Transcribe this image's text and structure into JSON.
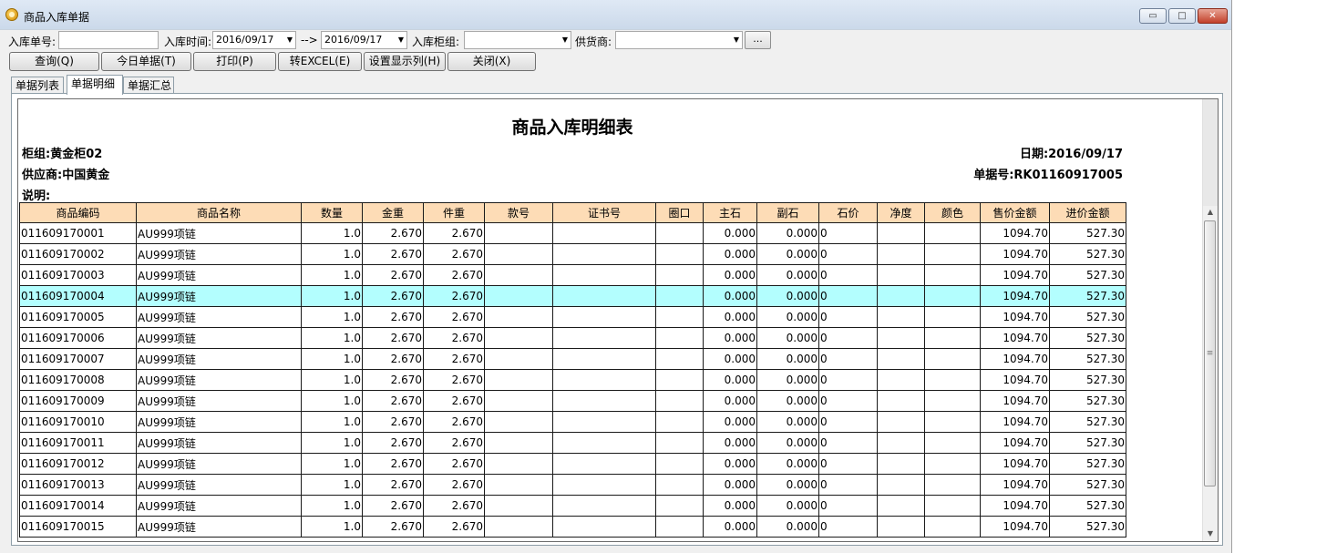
{
  "window": {
    "title": "商品入库单据",
    "min_label": "▭",
    "max_label": "□",
    "close_label": "✕"
  },
  "filters": {
    "order_no_label": "入库单号:",
    "order_no_value": "",
    "time_label": "入库时间:",
    "date_from": "2016/09/17",
    "arrow": "-->",
    "date_to": "2016/09/17",
    "counter_label": "入库柜组:",
    "counter_value": "",
    "supplier_label": "供货商:",
    "supplier_value": "",
    "more_label": "..."
  },
  "toolbar": {
    "query": "查询(Q)",
    "today": "今日单据(T)",
    "print": "打印(P)",
    "excel": "转EXCEL(E)",
    "columns": "设置显示列(H)",
    "close": "关闭(X)"
  },
  "tabs": [
    "单据列表",
    "单据明细",
    "单据汇总"
  ],
  "active_tab": "单据明细",
  "report": {
    "title": "商品入库明细表",
    "counter": "柜组:黄金柜02",
    "supplier": "供应商:中国黄金",
    "note": "说明:",
    "date": "日期:2016/09/17",
    "doc_no": "单据号:RK01160917005"
  },
  "table": {
    "headers": [
      "商品编码",
      "商品名称",
      "数量",
      "金重",
      "件重",
      "款号",
      "证书号",
      "圈口",
      "主石",
      "副石",
      "石价",
      "净度",
      "颜色",
      "售价金额",
      "进价金额"
    ],
    "rows": [
      [
        "011609170001",
        "AU999项链",
        "1.0",
        "2.670",
        "2.670",
        "",
        "",
        "",
        "0.000",
        "0.000",
        "0",
        "",
        "",
        "1094.70",
        "527.30"
      ],
      [
        "011609170002",
        "AU999项链",
        "1.0",
        "2.670",
        "2.670",
        "",
        "",
        "",
        "0.000",
        "0.000",
        "0",
        "",
        "",
        "1094.70",
        "527.30"
      ],
      [
        "011609170003",
        "AU999项链",
        "1.0",
        "2.670",
        "2.670",
        "",
        "",
        "",
        "0.000",
        "0.000",
        "0",
        "",
        "",
        "1094.70",
        "527.30"
      ],
      [
        "011609170004",
        "AU999项链",
        "1.0",
        "2.670",
        "2.670",
        "",
        "",
        "",
        "0.000",
        "0.000",
        "0",
        "",
        "",
        "1094.70",
        "527.30"
      ],
      [
        "011609170005",
        "AU999项链",
        "1.0",
        "2.670",
        "2.670",
        "",
        "",
        "",
        "0.000",
        "0.000",
        "0",
        "",
        "",
        "1094.70",
        "527.30"
      ],
      [
        "011609170006",
        "AU999项链",
        "1.0",
        "2.670",
        "2.670",
        "",
        "",
        "",
        "0.000",
        "0.000",
        "0",
        "",
        "",
        "1094.70",
        "527.30"
      ],
      [
        "011609170007",
        "AU999项链",
        "1.0",
        "2.670",
        "2.670",
        "",
        "",
        "",
        "0.000",
        "0.000",
        "0",
        "",
        "",
        "1094.70",
        "527.30"
      ],
      [
        "011609170008",
        "AU999项链",
        "1.0",
        "2.670",
        "2.670",
        "",
        "",
        "",
        "0.000",
        "0.000",
        "0",
        "",
        "",
        "1094.70",
        "527.30"
      ],
      [
        "011609170009",
        "AU999项链",
        "1.0",
        "2.670",
        "2.670",
        "",
        "",
        "",
        "0.000",
        "0.000",
        "0",
        "",
        "",
        "1094.70",
        "527.30"
      ],
      [
        "011609170010",
        "AU999项链",
        "1.0",
        "2.670",
        "2.670",
        "",
        "",
        "",
        "0.000",
        "0.000",
        "0",
        "",
        "",
        "1094.70",
        "527.30"
      ],
      [
        "011609170011",
        "AU999项链",
        "1.0",
        "2.670",
        "2.670",
        "",
        "",
        "",
        "0.000",
        "0.000",
        "0",
        "",
        "",
        "1094.70",
        "527.30"
      ],
      [
        "011609170012",
        "AU999项链",
        "1.0",
        "2.670",
        "2.670",
        "",
        "",
        "",
        "0.000",
        "0.000",
        "0",
        "",
        "",
        "1094.70",
        "527.30"
      ],
      [
        "011609170013",
        "AU999项链",
        "1.0",
        "2.670",
        "2.670",
        "",
        "",
        "",
        "0.000",
        "0.000",
        "0",
        "",
        "",
        "1094.70",
        "527.30"
      ],
      [
        "011609170014",
        "AU999项链",
        "1.0",
        "2.670",
        "2.670",
        "",
        "",
        "",
        "0.000",
        "0.000",
        "0",
        "",
        "",
        "1094.70",
        "527.30"
      ],
      [
        "011609170015",
        "AU999项链",
        "1.0",
        "2.670",
        "2.670",
        "",
        "",
        "",
        "0.000",
        "0.000",
        "0",
        "",
        "",
        "1094.70",
        "527.30"
      ]
    ],
    "selected_row": 3
  },
  "colors": {
    "header_bg": "#fddcb6",
    "selected_row_bg": "#b3fefe"
  }
}
